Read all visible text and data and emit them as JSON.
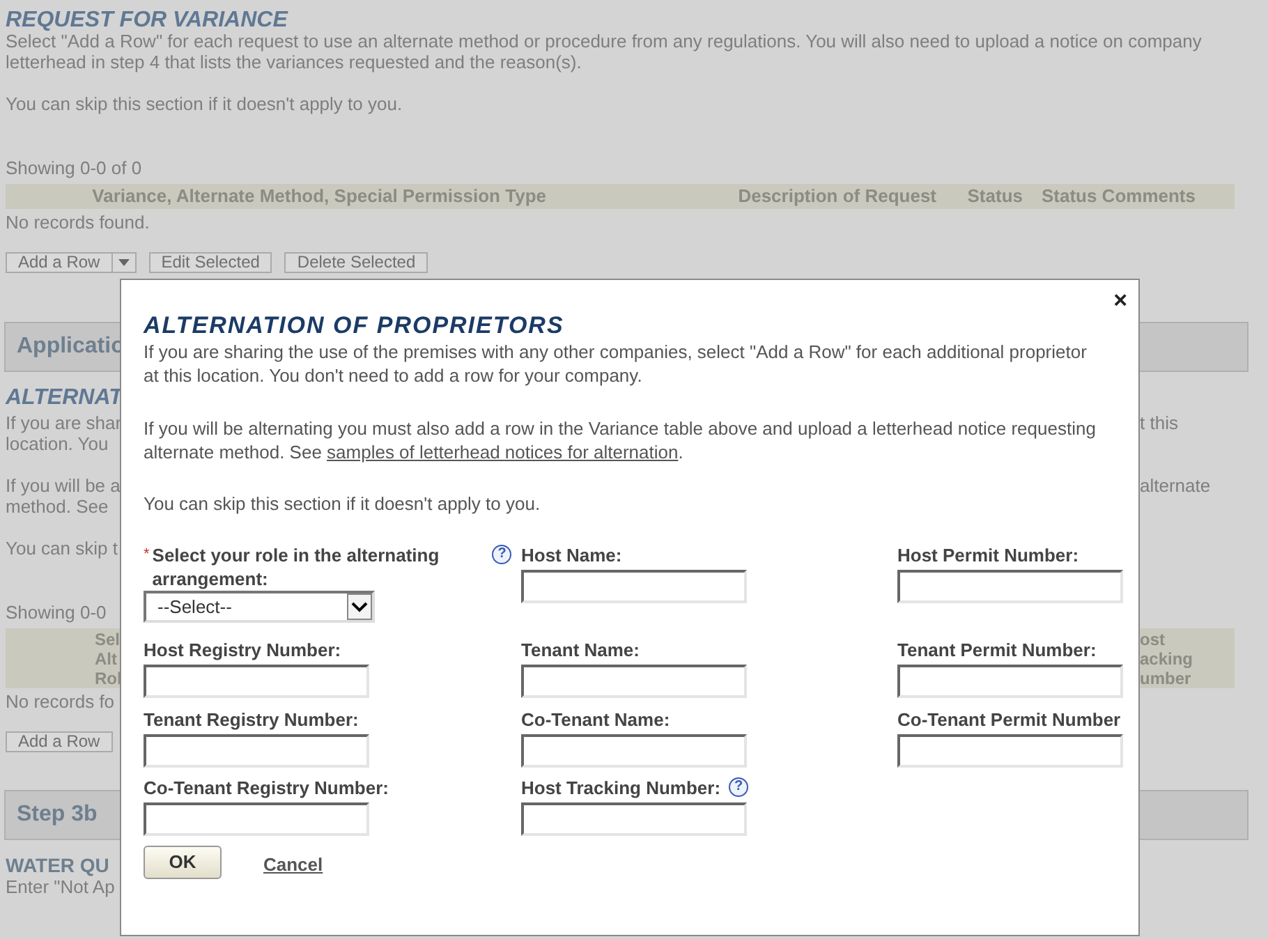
{
  "background": {
    "variance": {
      "title": "REQUEST FOR VARIANCE",
      "paragraphs": [
        "Select \"Add a Row\" for each request to use an alternate method or procedure from any regulations. You will also need to upload a notice on company letterhead in step 4 that lists the variances requested and the reason(s).",
        "You can skip this section if it doesn't apply to you."
      ],
      "showing": "Showing 0-0 of 0",
      "columns": [
        "Variance, Alternate Method, Special Permission Type",
        "Description of Request",
        "Status",
        "Status Comments"
      ],
      "empty": "No records found.",
      "buttons": [
        "Add a Row",
        "Edit Selected",
        "Delete Selected"
      ]
    },
    "application_header": "Applicatio",
    "alternation": {
      "title": "ALTERNAT",
      "paragraphs": [
        [
          {
            "left": "If you are shar",
            "right": "t this"
          },
          {
            "left": "location. You"
          }
        ],
        [
          {
            "left": "If you will be a",
            "right": "alternate"
          },
          {
            "left": "method. See"
          }
        ],
        [
          {
            "left": "You can skip t"
          }
        ]
      ],
      "showing": "Showing 0-0",
      "column_left": [
        "Sel",
        "Alt",
        "Rol"
      ],
      "column_right": [
        "ost",
        "acking",
        "umber"
      ],
      "empty": "No records fo",
      "button": "Add a Row"
    },
    "step_header": "Step 3b",
    "water": {
      "title": "WATER QU",
      "text": "Enter \"Not Ap"
    }
  },
  "dialog": {
    "title": "ALTERNATION OF PROPRIETORS",
    "close": "×",
    "paragraph_1": [
      "If you are sharing the use of the premises with any other companies, select \"Add a Row\" for each additional proprietor",
      "at this location. You don't need to add a row for your company."
    ],
    "paragraph_2": {
      "line_1": "If you will be alternating you must also add a row in the Variance table above and upload a letterhead notice requesting",
      "line_2": "alternate method. See ",
      "link": "samples of letterhead notices for alternation",
      "after": "."
    },
    "skip": "You can skip this section if it doesn't apply to you.",
    "fields": [
      {
        "label": "Select your role in the alternating arrangement:",
        "kind": "select",
        "required": "*",
        "help": "?",
        "value": "--Select--"
      },
      {
        "label": "Host Name:",
        "kind": "text"
      },
      {
        "label": "Host Permit Number:",
        "kind": "text"
      },
      {
        "label": "Host Registry Number:",
        "kind": "text"
      },
      {
        "label": "Tenant Name:",
        "kind": "text"
      },
      {
        "label": "Tenant Permit Number:",
        "kind": "text"
      },
      {
        "label": "Tenant Registry Number:",
        "kind": "text"
      },
      {
        "label": "Co-Tenant Name:",
        "kind": "text"
      },
      {
        "label": "Co-Tenant Permit Number",
        "kind": "text"
      },
      {
        "label": "Co-Tenant Registry Number:",
        "kind": "text"
      },
      {
        "label": "Host Tracking Number:",
        "kind": "text",
        "help": "?"
      }
    ],
    "ok": "OK",
    "cancel": "Cancel"
  }
}
